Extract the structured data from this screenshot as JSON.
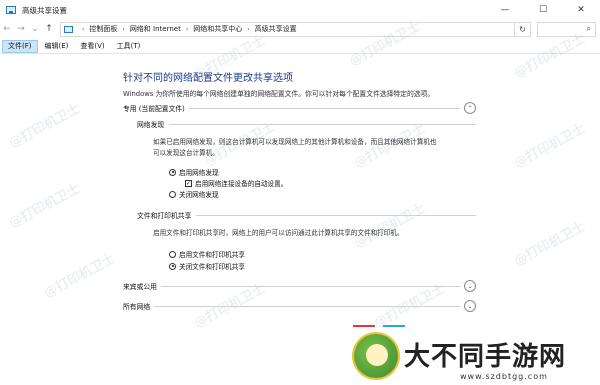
{
  "window": {
    "title": "高级共享设置",
    "minimize": "—",
    "maximize": "☐",
    "close": "✕"
  },
  "address": {
    "crumbs": [
      "控制面板",
      "网络和 Internet",
      "网络和共享中心",
      "高级共享设置"
    ],
    "refresh_glyph": "↻",
    "search_glyph": "⌕"
  },
  "menu": {
    "items": [
      "文件(F)",
      "编辑(E)",
      "查看(V)",
      "工具(T)"
    ]
  },
  "main": {
    "title": "针对不同的网络配置文件更改共享选项",
    "description": "Windows 为你所使用的每个网络创建单独的网络配置文件。你可以针对每个配置文件选择特定的选项。",
    "profile_private": {
      "label": "专用 (当前配置文件)",
      "chevron": "⌃",
      "discovery": {
        "label": "网络发现",
        "text_line1": "如果已启用网络发现，则这台计算机可以发现网络上的其他计算机和设备，而且其他网络计算机也",
        "text_line2": "可以发现这台计算机。",
        "option_on": "启用网络发现",
        "auto_setup": "启用网络连接设备的自动设置。",
        "option_off": "关闭网络发现"
      },
      "sharing": {
        "label": "文件和打印机共享",
        "text": "启用文件和打印机共享时，网络上的用户可以访问通过此计算机共享的文件和打印机。",
        "option_on": "启用文件和打印机共享",
        "option_off": "关闭文件和打印机共享"
      }
    },
    "profile_guest": {
      "label": "来宾或公用",
      "chevron": "⌄"
    },
    "profile_all": {
      "label": "所有网络",
      "chevron": "⌄"
    }
  },
  "watermark_text": "@打印机卫士",
  "logo": {
    "name": "大不同手游网",
    "url": "www.szdbtgg.com"
  },
  "colors": {
    "title_blue": "#1e3a8a",
    "menu_active": "#cce4f7",
    "accent_red": "#e53935",
    "accent_blue": "#29a8e0"
  }
}
